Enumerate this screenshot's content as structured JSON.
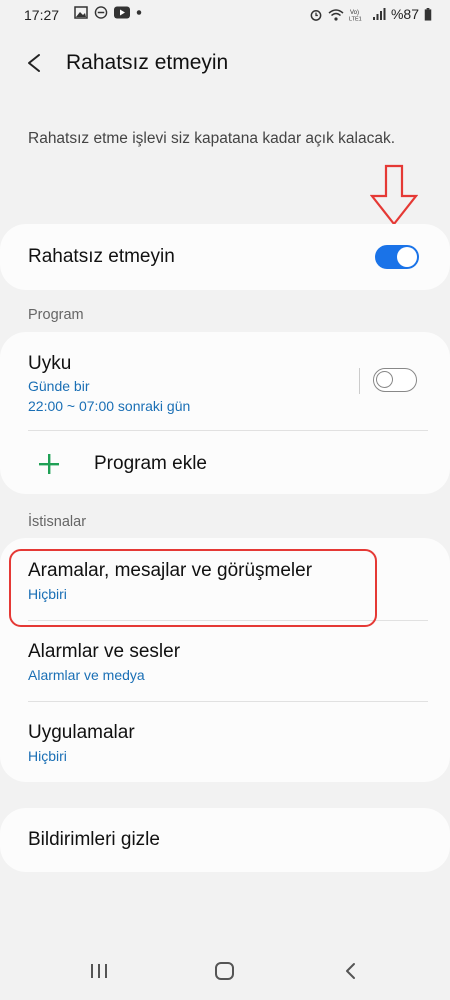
{
  "status_bar": {
    "time": "17:27",
    "battery": "%87",
    "left_icons": [
      "image-icon",
      "dnd-icon",
      "youtube-icon",
      "dot-icon"
    ],
    "right_icons": [
      "alarm-icon",
      "wifi-icon",
      "volte-icon",
      "signal-icon",
      "battery-icon"
    ]
  },
  "header": {
    "title": "Rahatsız etmeyin"
  },
  "description": "Rahatsız etme işlevi siz kapatana kadar açık kalacak.",
  "dnd_toggle": {
    "label": "Rahatsız etmeyin",
    "checked": true
  },
  "program": {
    "header": "Program",
    "schedule": {
      "title": "Uyku",
      "frequency": "Günde bir",
      "time": "22:00 ~ 07:00 sonraki gün",
      "enabled": false
    },
    "add_label": "Program ekle"
  },
  "exceptions": {
    "header": "İstisnalar",
    "items": [
      {
        "title": "Aramalar, mesajlar ve görüşmeler",
        "subtitle": "Hiçbiri"
      },
      {
        "title": "Alarmlar ve sesler",
        "subtitle": "Alarmlar ve medya"
      },
      {
        "title": "Uygulamalar",
        "subtitle": "Hiçbiri"
      }
    ]
  },
  "hide_notifications": {
    "label": "Bildirimleri gizle"
  },
  "colors": {
    "accent": "#1a73e8",
    "subtitle": "#1a6fb5",
    "highlight": "#e53935",
    "add": "#1fa055"
  }
}
